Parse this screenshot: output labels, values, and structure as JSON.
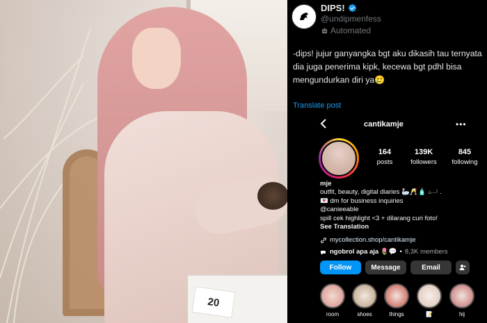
{
  "photo": {
    "table_card_number": "20"
  },
  "tweet": {
    "display_name": "DIPS!",
    "handle": "@undipmenfess",
    "automated_label": "Automated",
    "text": "-dips! jujur ganyangka bgt aku dikasih tau ternyata dia juga penerima kipk, kecewa bgt pdhl bisa mengundurkan diri ya🥲",
    "translate_label": "Translate post",
    "colors": {
      "link": "#1d9bf0",
      "verified": "#1d9bf0"
    }
  },
  "instagram": {
    "username": "cantikamje",
    "more_label": "•••",
    "stats": {
      "posts": {
        "value": "164",
        "label": "posts"
      },
      "followers": {
        "value": "139K",
        "label": "followers"
      },
      "following": {
        "value": "845",
        "label": "following"
      }
    },
    "bio": {
      "name": "mje",
      "line1": "outfit, beauty, digital diaries 🦢🥂🧴 𓂟 .",
      "line2": "💌 dm for business inquiries",
      "line3": "@canieeable",
      "line4": "spill cek highlight <3 + dilarang curi foto!",
      "see_translation": "See Translation"
    },
    "link": "mycollection.shop/cantikamje",
    "channel": {
      "name": "ngobrol apa aja 🌷💬",
      "separator": "•",
      "members": "8,3K members"
    },
    "buttons": {
      "follow": "Follow",
      "message": "Message",
      "email": "Email"
    },
    "highlights": [
      {
        "label": "room"
      },
      {
        "label": "shoes"
      },
      {
        "label": "things"
      },
      {
        "label": "📝"
      },
      {
        "label": "hij"
      }
    ],
    "colors": {
      "follow_button": "#0095f6",
      "secondary_button": "#363636"
    }
  }
}
